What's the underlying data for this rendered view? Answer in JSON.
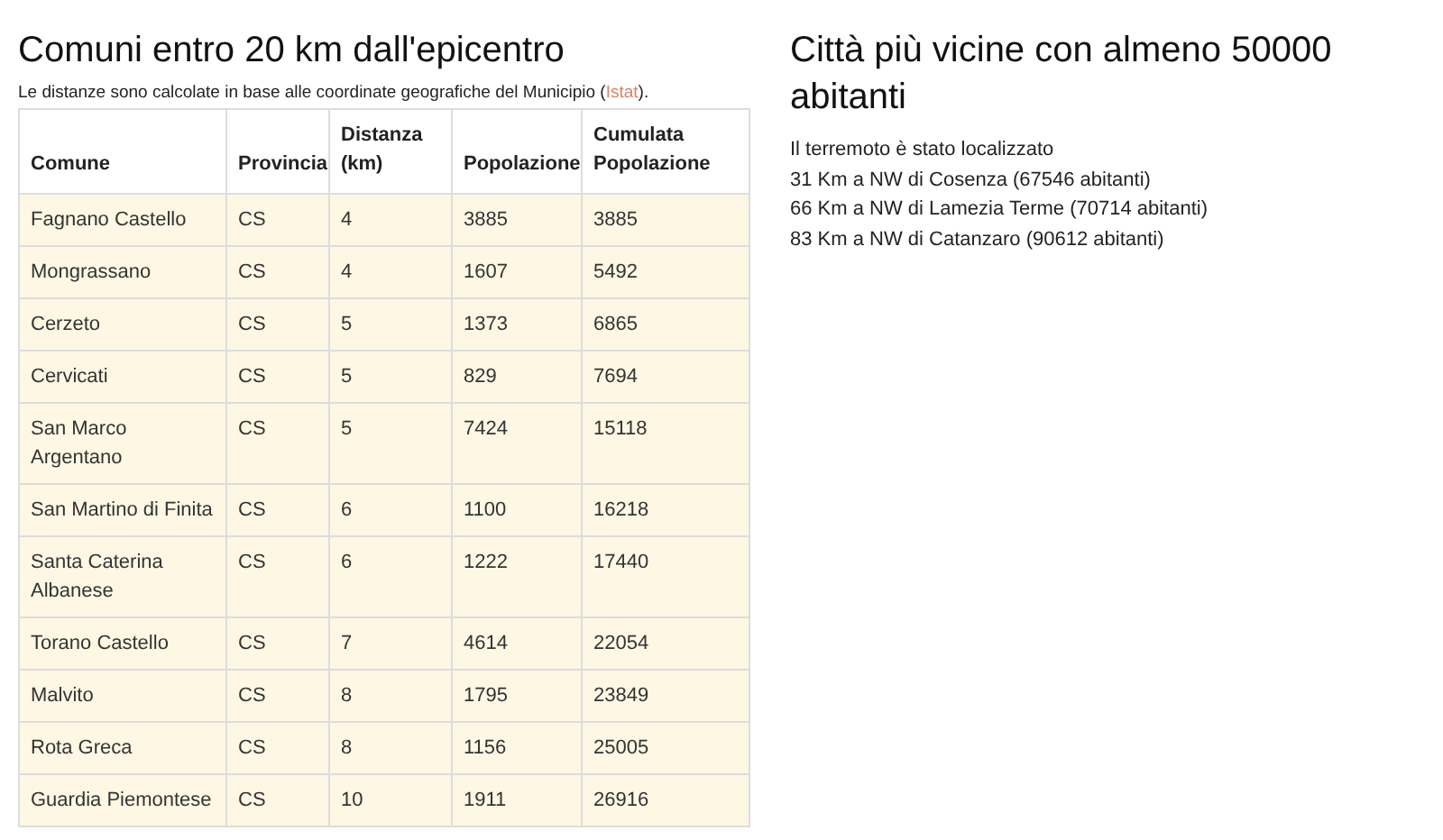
{
  "left": {
    "title": "Comuni entro 20 km dall'epicentro",
    "note": {
      "before": "Le distanze sono calcolate in base alle coordinate geografiche del Municipio (",
      "link": "Istat",
      "after": ")."
    },
    "table": {
      "columns": [
        "Comune",
        "Provincia",
        "Distanza (km)",
        "Popolazione",
        "Cumulata Popolazione"
      ],
      "rows": [
        [
          "Fagnano Castello",
          "CS",
          "4",
          "3885",
          "3885"
        ],
        [
          "Mongrassano",
          "CS",
          "4",
          "1607",
          "5492"
        ],
        [
          "Cerzeto",
          "CS",
          "5",
          "1373",
          "6865"
        ],
        [
          "Cervicati",
          "CS",
          "5",
          "829",
          "7694"
        ],
        [
          "San Marco Argentano",
          "CS",
          "5",
          "7424",
          "15118"
        ],
        [
          "San Martino di Finita",
          "CS",
          "6",
          "1100",
          "16218"
        ],
        [
          "Santa Caterina Albanese",
          "CS",
          "6",
          "1222",
          "17440"
        ],
        [
          "Torano Castello",
          "CS",
          "7",
          "4614",
          "22054"
        ],
        [
          "Malvito",
          "CS",
          "8",
          "1795",
          "23849"
        ],
        [
          "Rota Greca",
          "CS",
          "8",
          "1156",
          "25005"
        ],
        [
          "Guardia Piemontese",
          "CS",
          "10",
          "1911",
          "26916"
        ]
      ]
    }
  },
  "right": {
    "title": "Città più vicine con almeno 50000 abitanti",
    "lines": [
      "Il terremoto è stato localizzato",
      "31 Km a NW di Cosenza (67546 abitanti)",
      "66 Km a NW di Lamezia Terme (70714 abitanti)",
      "83 Km a NW di Catanzaro (90612 abitanti)"
    ]
  }
}
